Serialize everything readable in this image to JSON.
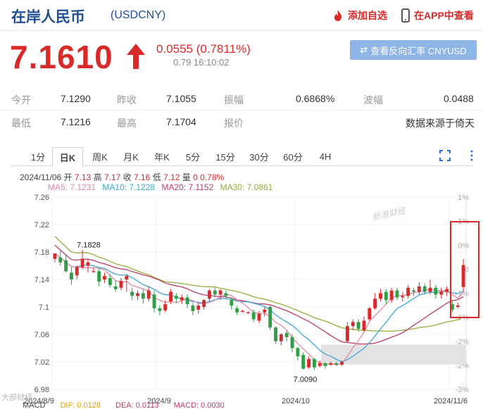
{
  "header": {
    "title": "在岸人民币",
    "code": "(USDCNY)",
    "watch_label": "添加自选",
    "app_label": "在APP中查看"
  },
  "quote": {
    "price": "7.1610",
    "change": "0.0555 (0.7811%)",
    "timestamp": "0.79 16:10:02",
    "reverse_label": "查看反向汇率 CNYUSD"
  },
  "stats": {
    "row1": [
      {
        "label": "今开",
        "value": "7.1290"
      },
      {
        "label": "昨收",
        "value": "7.1055"
      },
      {
        "label": "振幅",
        "value": "0.6868%"
      },
      {
        "label": "波幅",
        "value": "0.0488"
      }
    ],
    "row2": [
      {
        "label": "最低",
        "value": "7.1216"
      },
      {
        "label": "最高",
        "value": "7.1704"
      },
      {
        "label": "报价",
        "value": ""
      },
      {
        "label": "",
        "value": "数据来源于倚天"
      }
    ]
  },
  "tabs": [
    "1分",
    "日K",
    "周K",
    "月K",
    "年K",
    "5分",
    "15分",
    "30分",
    "60分",
    "4H"
  ],
  "active_tab": "日K",
  "ohlc_line": {
    "date": "2024/11/06",
    "open_label": "开",
    "open": "7.13",
    "high_label": "高",
    "high": "7.17",
    "close_label": "收",
    "close": "7.16",
    "low_label": "低",
    "low": "7.12",
    "vol_label": "量",
    "vol": "0",
    "pct": "0.78%"
  },
  "ma": {
    "ma5": "MA5: 7.1231",
    "ma10": "MA10: 7.1228",
    "ma20": "MA20: 7.1152",
    "ma30": "MA30: 7.0861"
  },
  "colors": {
    "up": "#d92a2a",
    "down": "#2f9e44",
    "ma5": "#e58aa6",
    "ma10": "#3aa9d6",
    "ma20": "#c23a6a",
    "ma30": "#9aab3a",
    "brand": "#1e4f96"
  },
  "watermark": "新浪财经",
  "wechat_tag": "大部财经",
  "bottom_indicators": {
    "macd": "MACD",
    "dif": "DIF: 0.0128",
    "dea": "DEA: 0.0113",
    "macd_val": "MACD: 0.0030"
  },
  "chart_data": {
    "type": "candlestick",
    "ylim": [
      6.98,
      7.26
    ],
    "y_ticks": [
      "7.26",
      "7.22",
      "7.18",
      "7.14",
      "7.1",
      "7.06",
      "7.02",
      "6.98"
    ],
    "right_ticks": [
      "1%",
      "1%",
      "0%",
      "0",
      "-1%",
      "-1%",
      "-2%",
      "-2%",
      "-3%"
    ],
    "x_labels": [
      "2024/8/9",
      "2024/9",
      "2024/10",
      "2024/11/6"
    ],
    "annotations": [
      {
        "text": "7.1828",
        "value": 7.1828
      },
      {
        "text": "7.0090",
        "value": 7.009
      }
    ],
    "candles": [
      [
        7.17,
        7.178,
        7.178,
        7.165
      ],
      [
        7.172,
        7.165,
        7.182,
        7.16
      ],
      [
        7.168,
        7.152,
        7.175,
        7.15
      ],
      [
        7.15,
        7.14,
        7.158,
        7.132
      ],
      [
        7.146,
        7.158,
        7.16,
        7.14
      ],
      [
        7.158,
        7.17,
        7.183,
        7.155
      ],
      [
        7.16,
        7.165,
        7.17,
        7.15
      ],
      [
        7.152,
        7.152,
        7.157,
        7.15
      ],
      [
        7.152,
        7.137,
        7.156,
        7.13
      ],
      [
        7.14,
        7.145,
        7.15,
        7.135
      ],
      [
        7.142,
        7.132,
        7.148,
        7.128
      ],
      [
        7.13,
        7.126,
        7.138,
        7.122
      ],
      [
        7.128,
        7.138,
        7.142,
        7.124
      ],
      [
        7.14,
        7.145,
        7.148,
        7.122
      ],
      [
        7.122,
        7.116,
        7.128,
        7.11
      ],
      [
        7.116,
        7.12,
        7.124,
        7.11
      ],
      [
        7.12,
        7.112,
        7.126,
        7.105
      ],
      [
        7.112,
        7.124,
        7.13,
        7.108
      ],
      [
        7.118,
        7.098,
        7.124,
        7.092
      ],
      [
        7.098,
        7.094,
        7.102,
        7.088
      ],
      [
        7.095,
        7.104,
        7.11,
        7.092
      ],
      [
        7.108,
        7.122,
        7.126,
        7.104
      ],
      [
        7.116,
        7.112,
        7.12,
        7.106
      ],
      [
        7.11,
        7.114,
        7.118,
        7.104
      ],
      [
        7.114,
        7.104,
        7.118,
        7.098
      ],
      [
        7.102,
        7.094,
        7.106,
        7.088
      ],
      [
        7.096,
        7.102,
        7.106,
        7.09
      ],
      [
        7.1,
        7.11,
        7.112,
        7.096
      ],
      [
        7.112,
        7.124,
        7.126,
        7.108
      ],
      [
        7.124,
        7.118,
        7.128,
        7.114
      ],
      [
        7.118,
        7.124,
        7.126,
        7.11
      ],
      [
        7.12,
        7.116,
        7.124,
        7.112
      ],
      [
        7.11,
        7.102,
        7.114,
        7.096
      ],
      [
        7.098,
        7.092,
        7.102,
        7.088
      ],
      [
        7.094,
        7.094,
        7.096,
        7.092
      ],
      [
        7.092,
        7.092,
        7.094,
        7.09
      ],
      [
        7.092,
        7.082,
        7.096,
        7.078
      ],
      [
        7.08,
        7.09,
        7.094,
        7.076
      ],
      [
        7.092,
        7.096,
        7.1,
        7.086
      ],
      [
        7.1,
        7.07,
        7.102,
        7.066
      ],
      [
        7.07,
        7.05,
        7.072,
        7.046
      ],
      [
        7.05,
        7.06,
        7.062,
        7.044
      ],
      [
        7.062,
        7.056,
        7.066,
        7.05
      ],
      [
        7.056,
        7.04,
        7.06,
        7.034
      ],
      [
        7.04,
        7.028,
        7.042,
        7.022
      ],
      [
        7.03,
        7.01,
        7.034,
        7.009
      ],
      [
        7.012,
        7.024,
        7.028,
        7.01
      ],
      [
        7.024,
        7.012,
        7.026,
        7.008
      ],
      [
        7.014,
        7.018,
        7.022,
        7.012
      ],
      [
        7.018,
        7.014,
        7.02,
        7.01
      ],
      [
        7.016,
        7.018,
        7.02,
        7.014
      ],
      [
        7.018,
        7.016,
        7.02,
        7.014
      ],
      [
        7.016,
        7.02,
        7.022,
        7.014
      ],
      [
        7.05,
        7.072,
        7.078,
        7.048
      ],
      [
        7.072,
        7.078,
        7.082,
        7.066
      ],
      [
        7.078,
        7.068,
        7.082,
        7.064
      ],
      [
        7.066,
        7.08,
        7.086,
        7.064
      ],
      [
        7.082,
        7.098,
        7.1,
        7.08
      ],
      [
        7.098,
        7.112,
        7.12,
        7.096
      ],
      [
        7.112,
        7.12,
        7.126,
        7.108
      ],
      [
        7.122,
        7.11,
        7.126,
        7.104
      ],
      [
        7.11,
        7.124,
        7.128,
        7.106
      ],
      [
        7.124,
        7.114,
        7.128,
        7.11
      ],
      [
        7.114,
        7.116,
        7.122,
        7.108
      ],
      [
        7.116,
        7.128,
        7.132,
        7.112
      ],
      [
        7.124,
        7.122,
        7.128,
        7.116
      ],
      [
        7.122,
        7.13,
        7.136,
        7.118
      ],
      [
        7.13,
        7.122,
        7.134,
        7.118
      ],
      [
        7.122,
        7.128,
        7.14,
        7.118
      ],
      [
        7.128,
        7.118,
        7.132,
        7.112
      ],
      [
        7.118,
        7.122,
        7.128,
        7.112
      ],
      [
        7.122,
        7.126,
        7.13,
        7.116
      ],
      [
        7.104,
        7.096,
        7.108,
        7.092
      ],
      [
        7.1,
        7.102,
        7.106,
        7.098
      ],
      [
        7.129,
        7.161,
        7.17,
        7.122
      ]
    ]
  }
}
